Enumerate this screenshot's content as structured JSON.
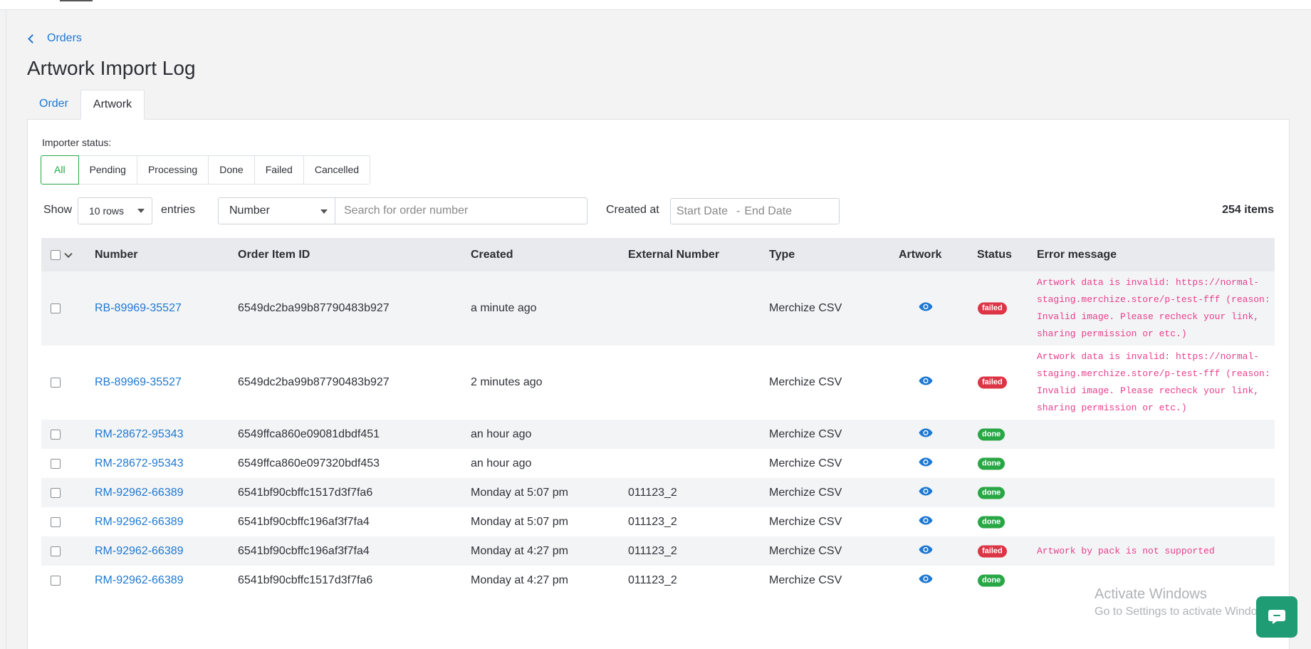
{
  "nav": {
    "back_label": "Orders"
  },
  "page": {
    "title": "Artwork Import Log"
  },
  "tabs": [
    {
      "label": "Order",
      "active": false
    },
    {
      "label": "Artwork",
      "active": true
    }
  ],
  "filters": {
    "status_label": "Importer status:",
    "statuses": [
      "All",
      "Pending",
      "Processing",
      "Done",
      "Failed",
      "Cancelled"
    ],
    "active_status": "All",
    "show_label": "Show",
    "rows_value": "10 rows",
    "entries_label": "entries",
    "search_field": "Number",
    "search_placeholder": "Search for order number",
    "created_label": "Created at",
    "start_date_placeholder": "Start Date",
    "date_separator": "-",
    "end_date_placeholder": "End Date",
    "count": "254 items"
  },
  "table": {
    "columns": [
      "Number",
      "Order Item ID",
      "Created",
      "External Number",
      "Type",
      "Artwork",
      "Status",
      "Error message"
    ],
    "rows": [
      {
        "number": "RB-89969-35527",
        "item_id": "6549dc2ba99b87790483b927",
        "created": "a minute ago",
        "external": "",
        "type": "Merchize CSV",
        "status": "failed",
        "error": "Artwork data is invalid: https://normal-staging.merchize.store/p-test-fff (reason: Invalid image. Please recheck your link, sharing permission or etc.)"
      },
      {
        "number": "RB-89969-35527",
        "item_id": "6549dc2ba99b87790483b927",
        "created": "2 minutes ago",
        "external": "",
        "type": "Merchize CSV",
        "status": "failed",
        "error": "Artwork data is invalid: https://normal-staging.merchize.store/p-test-fff (reason: Invalid image. Please recheck your link, sharing permission or etc.)"
      },
      {
        "number": "RM-28672-95343",
        "item_id": "6549ffca860e09081dbdf451",
        "created": "an hour ago",
        "external": "",
        "type": "Merchize CSV",
        "status": "done",
        "error": ""
      },
      {
        "number": "RM-28672-95343",
        "item_id": "6549ffca860e097320bdf453",
        "created": "an hour ago",
        "external": "",
        "type": "Merchize CSV",
        "status": "done",
        "error": ""
      },
      {
        "number": "RM-92962-66389",
        "item_id": "6541bf90cbffc1517d3f7fa6",
        "created": "Monday at 5:07 pm",
        "external": "011123_2",
        "type": "Merchize CSV",
        "status": "done",
        "error": ""
      },
      {
        "number": "RM-92962-66389",
        "item_id": "6541bf90cbffc196af3f7fa4",
        "created": "Monday at 5:07 pm",
        "external": "011123_2",
        "type": "Merchize CSV",
        "status": "done",
        "error": ""
      },
      {
        "number": "RM-92962-66389",
        "item_id": "6541bf90cbffc196af3f7fa4",
        "created": "Monday at 4:27 pm",
        "external": "011123_2",
        "type": "Merchize CSV",
        "status": "failed",
        "error": "Artwork by pack is not supported"
      },
      {
        "number": "RM-92962-66389",
        "item_id": "6541bf90cbffc1517d3f7fa6",
        "created": "Monday at 4:27 pm",
        "external": "011123_2",
        "type": "Merchize CSV",
        "status": "done",
        "error": ""
      }
    ]
  },
  "overlay": {
    "watermark_title": "Activate Windows",
    "watermark_sub": "Go to Settings to activate Windows."
  },
  "colors": {
    "link": "#1f78d1",
    "failed": "#dc3545",
    "done": "#28a745",
    "error_text": "#e83e8c",
    "chat": "#1f9c74"
  }
}
